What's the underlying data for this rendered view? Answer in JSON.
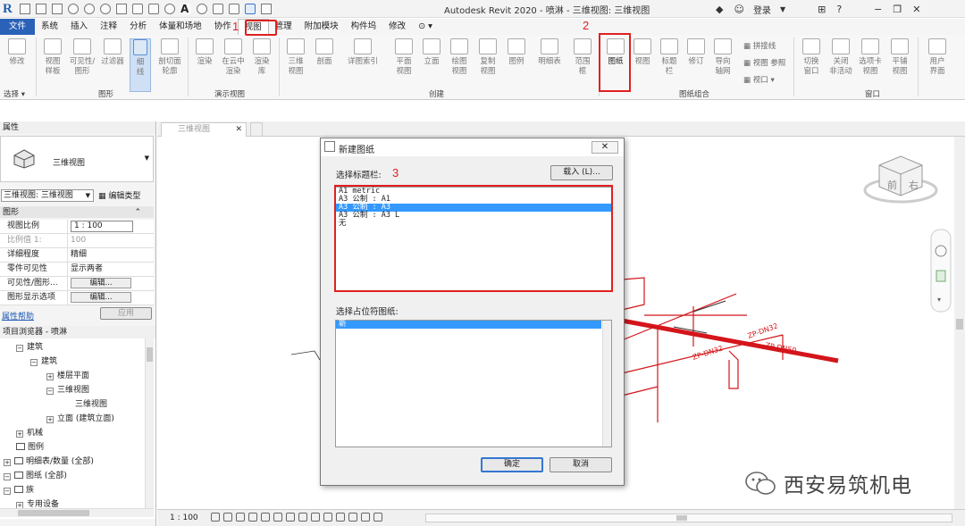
{
  "title_bar": {
    "app_title": "Autodesk Revit 2020 - 喷淋 - 三维视图: 三维视图",
    "login": "登录"
  },
  "menu": {
    "tabs": [
      "文件",
      "系统",
      "插入",
      "注释",
      "分析",
      "体量和场地",
      "协作",
      "视图",
      "管理",
      "附加模块",
      "构件坞",
      "修改"
    ],
    "active": "视图"
  },
  "annotations": {
    "step1": "1",
    "step2": "2",
    "step3": "3"
  },
  "ribbon": {
    "select": {
      "label": "修改",
      "panel": "选择"
    },
    "graphics": {
      "buttons": [
        "视图\n样板",
        "可见性/\n图形",
        "过滤器",
        "细\n线",
        "剖切面\n轮廓"
      ],
      "panel": "图形"
    },
    "presentation": {
      "buttons": [
        "渲染",
        "在云中\n渲染",
        "渲染\n库"
      ],
      "panel": "演示视图"
    },
    "create": {
      "buttons": [
        "三维\n视图",
        "剖面",
        "详图索引",
        "平面\n视图",
        "立面",
        "绘图\n视图",
        "复制\n视图",
        "图例",
        "明细表",
        "范围\n框"
      ],
      "panel": "创建"
    },
    "sheet": {
      "buttons": [
        "图纸",
        "视图",
        "标题\n栏",
        "修订",
        "导向\n轴网"
      ],
      "small": [
        "拼接线",
        "视图 参照",
        "视口"
      ],
      "panel": "图纸组合"
    },
    "window": {
      "buttons": [
        "切换\n窗口",
        "关闭\n非活动",
        "选项卡\n视图",
        "平铺\n视图"
      ],
      "panel": "窗口"
    },
    "ui": {
      "button": "用户\n界面"
    }
  },
  "properties": {
    "header": "属性",
    "type_name": "三维视图",
    "selector": "三维视图: 三维视图",
    "edit_type": "编辑类型",
    "section": "图形",
    "rows": [
      {
        "key": "视图比例",
        "value": "1 : 100"
      },
      {
        "key": "比例值 1:",
        "value": "100"
      },
      {
        "key": "详细程度",
        "value": "精细"
      },
      {
        "key": "零件可见性",
        "value": "显示两者"
      },
      {
        "key": "可见性/图形...",
        "value": "编辑..."
      },
      {
        "key": "图形显示选项",
        "value": "编辑..."
      }
    ],
    "help": "属性帮助",
    "apply": "应用"
  },
  "browser": {
    "header": "项目浏览器 - 喷淋",
    "items": [
      "建筑",
      "建筑",
      "楼层平面",
      "三维视图",
      "三维视图",
      "立面 (建筑立面)",
      "机械",
      "图例",
      "明细表/数量 (全部)",
      "图纸 (全部)",
      "族",
      "专用设备"
    ]
  },
  "tabs": {
    "view_tab": "三维视图"
  },
  "dialog": {
    "title": "新建图纸",
    "titleblock_label": "选择标题栏:",
    "load_button": "载入 (L)...",
    "titleblocks": [
      "A1 metric",
      "A3 公制 : A1",
      "A3 公制 : A3",
      "A3 公制 : A3 L",
      "无"
    ],
    "selected_index": 2,
    "placeholder_label": "选择占位符图纸:",
    "placeholders": [
      "新"
    ],
    "ok": "确定",
    "cancel": "取消"
  },
  "drawing": {
    "pipe_labels": [
      "ZP-DN32",
      "ZP-DN32",
      "ZP-DN50"
    ],
    "viewcube": [
      "前",
      "右"
    ]
  },
  "status": {
    "scale": "1 : 100"
  },
  "watermark": "西安易筑机电",
  "colors": {
    "pipe": "#d4151b",
    "accent": "#2a62b8",
    "highlight": "#e02020",
    "selection": "#3399ff"
  }
}
